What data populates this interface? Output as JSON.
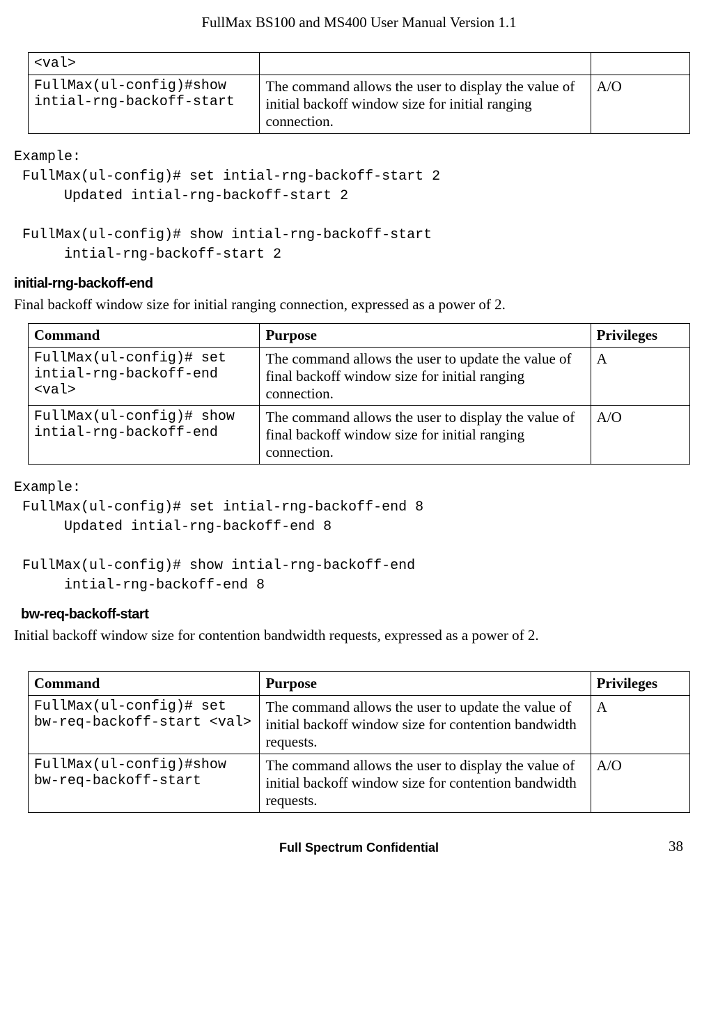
{
  "header_title": "FullMax BS100 and MS400 User Manual Version 1.1",
  "table0": {
    "rows": [
      {
        "cmd": "<val>",
        "purpose": "",
        "priv": ""
      },
      {
        "cmd": "FullMax(ul-config)#show intial-rng-backoff-start",
        "purpose": "The command allows the user to display the value of initial backoff window size for initial ranging connection.",
        "priv": "A/O"
      }
    ]
  },
  "example0": "Example:\n FullMax(ul-config)# set intial-rng-backoff-start 2\n      Updated intial-rng-backoff-start 2\n\n FullMax(ul-config)# show intial-rng-backoff-start\n      intial-rng-backoff-start 2",
  "section1": {
    "heading": "initial-rng-backoff-end",
    "desc": "Final backoff window size for initial ranging connection, expressed as a power of 2."
  },
  "table_headers": {
    "cmd": "Command",
    "purpose": "Purpose",
    "priv": "Privileges"
  },
  "table1": {
    "rows": [
      {
        "cmd": "FullMax(ul-config)# set intial-rng-backoff-end <val>",
        "purpose": "The command allows the user to update the value of final backoff window size for initial ranging connection.",
        "priv": "A"
      },
      {
        "cmd": "FullMax(ul-config)# show intial-rng-backoff-end",
        "purpose": "The command allows the user to display the value of final backoff window size for initial ranging connection.",
        "priv": "A/O"
      }
    ]
  },
  "example1": "Example:\n FullMax(ul-config)# set intial-rng-backoff-end 8\n      Updated intial-rng-backoff-end 8\n\n FullMax(ul-config)# show intial-rng-backoff-end\n      intial-rng-backoff-end 8",
  "section2": {
    "heading": "bw-req-backoff-start",
    "desc": "Initial backoff window size for contention bandwidth requests, expressed as a power of 2."
  },
  "table2": {
    "rows": [
      {
        "cmd": "FullMax(ul-config)# set bw-req-backoff-start <val>",
        "purpose": "The command allows the user to update the value of initial backoff window size for contention bandwidth requests.",
        "priv": "A"
      },
      {
        "cmd": "FullMax(ul-config)#show bw-req-backoff-start",
        "purpose": "The command allows the user to display the value of initial backoff window size for contention bandwidth requests.",
        "priv": "A/O"
      }
    ]
  },
  "footer_text": "Full Spectrum Confidential",
  "page_number": "38"
}
